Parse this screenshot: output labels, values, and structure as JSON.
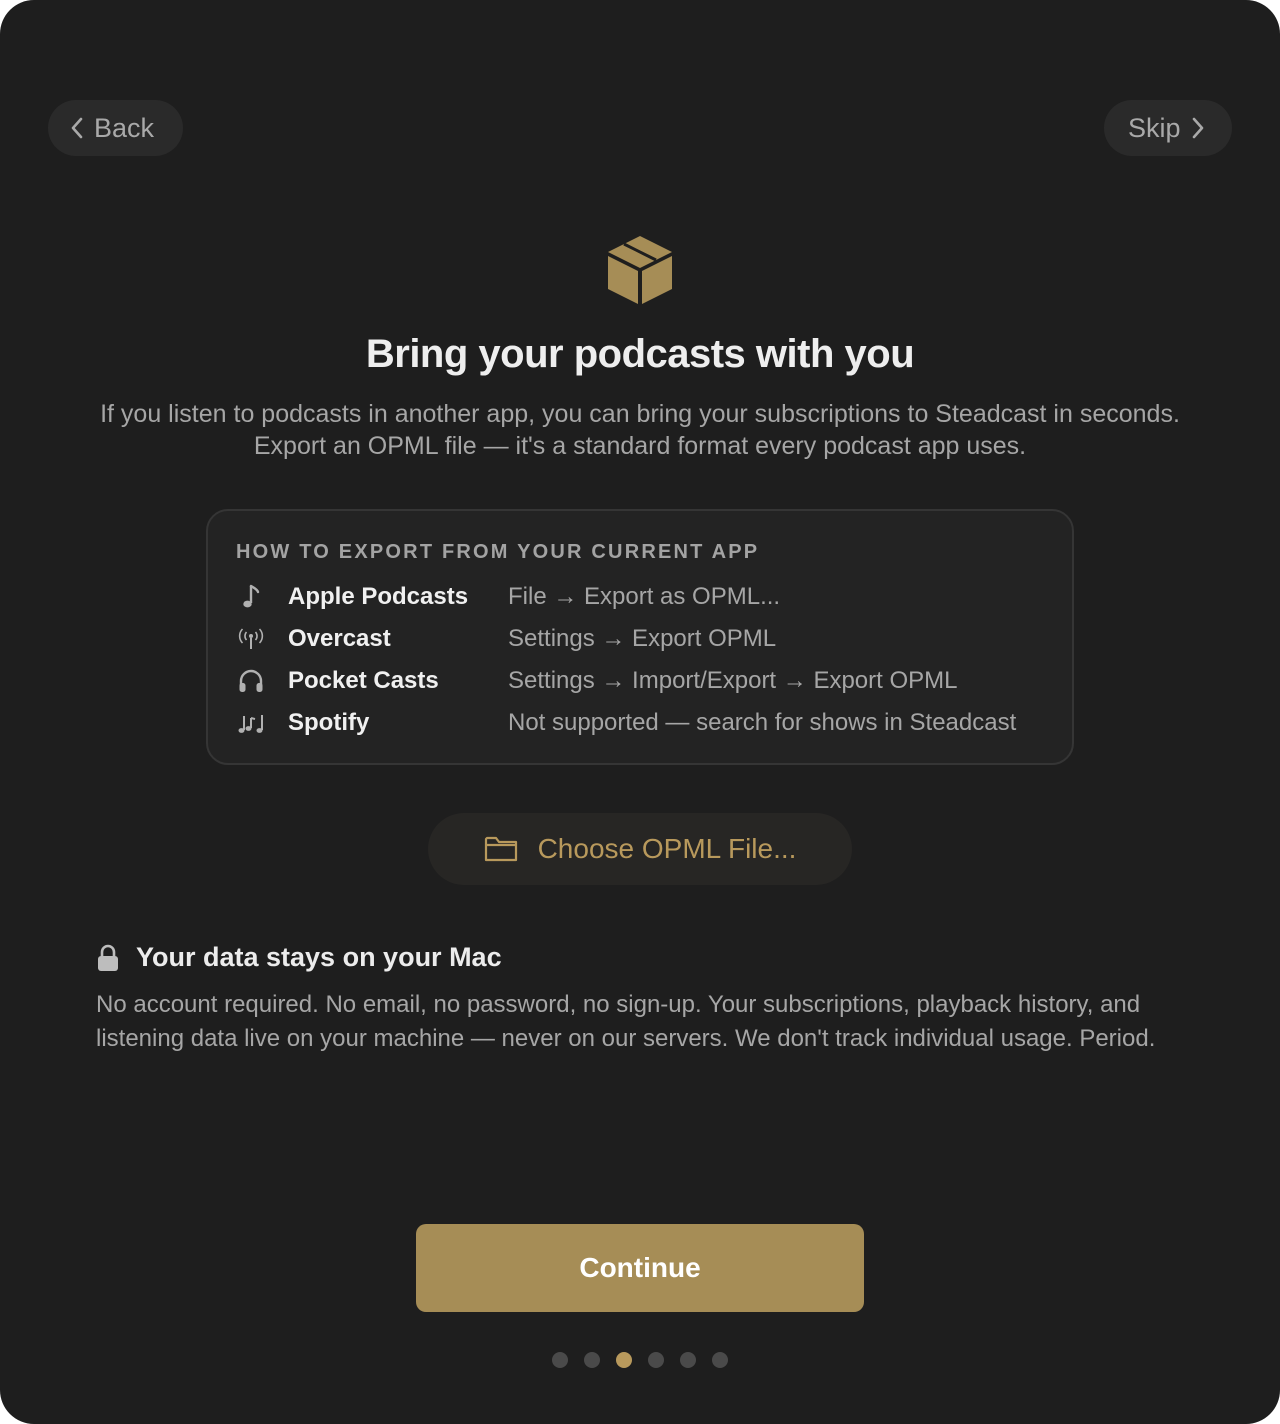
{
  "nav": {
    "back_label": "Back",
    "skip_label": "Skip"
  },
  "hero": {
    "icon": "shipping-box-icon",
    "title": "Bring your podcasts with you",
    "subtitle": "If you listen to podcasts in another app, you can bring your subscriptions to Steadcast in seconds. Export an OPML file — it's a standard format every podcast app uses."
  },
  "export_card": {
    "heading": "HOW TO EXPORT FROM YOUR CURRENT APP",
    "rows": [
      {
        "icon": "music-note-icon",
        "app": "Apple Podcasts",
        "steps": "File → Export as OPML..."
      },
      {
        "icon": "antenna-icon",
        "app": "Overcast",
        "steps": "Settings → Export OPML"
      },
      {
        "icon": "headphones-icon",
        "app": "Pocket Casts",
        "steps": "Settings → Import/Export → Export OPML"
      },
      {
        "icon": "music-notes-icon",
        "app": "Spotify",
        "steps": "Not supported — search for shows in Steadcast"
      }
    ]
  },
  "choose_file": {
    "icon": "folder-icon",
    "label": "Choose OPML File..."
  },
  "privacy": {
    "icon": "lock-icon",
    "title": "Your data stays on your Mac",
    "body": "No account required. No email, no password, no sign-up. Your subscriptions, playback history, and listening data live on your machine — never on our servers. We don't track individual usage. Period."
  },
  "continue_label": "Continue",
  "pagination": {
    "total": 6,
    "current": 3
  },
  "colors": {
    "background": "#1e1e1e",
    "accent": "#a68d56",
    "accent_text": "#b8995c"
  }
}
